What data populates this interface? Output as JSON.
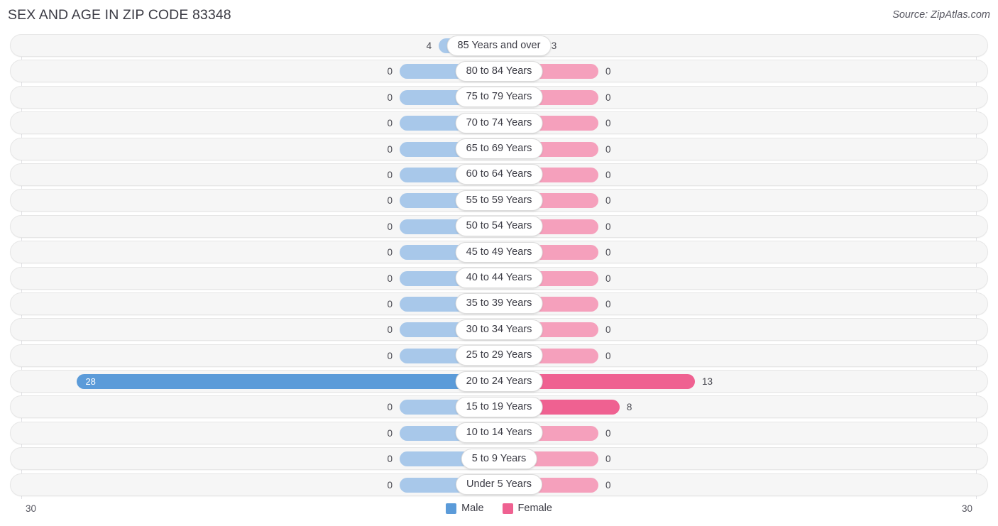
{
  "header": {
    "title": "SEX AND AGE IN ZIP CODE 83348",
    "source": "Source: ZipAtlas.com"
  },
  "legend": {
    "male_label": "Male",
    "female_label": "Female",
    "male_color": "#5b9bd9",
    "female_color": "#ef6191"
  },
  "axis": {
    "left_tick": "30",
    "right_tick": "30",
    "max": 30
  },
  "chart_data": {
    "type": "bar",
    "title": "SEX AND AGE IN ZIP CODE 83348",
    "subtitle": "Source: ZipAtlas.com",
    "orientation": "horizontal-diverging-population-pyramid",
    "xlabel": "",
    "ylabel": "",
    "xlim": [
      -30,
      30
    ],
    "axis_tick_labels": [
      "30",
      "30"
    ],
    "grid": false,
    "legend_position": "bottom-center",
    "categories": [
      "85 Years and over",
      "80 to 84 Years",
      "75 to 79 Years",
      "70 to 74 Years",
      "65 to 69 Years",
      "60 to 64 Years",
      "55 to 59 Years",
      "50 to 54 Years",
      "45 to 49 Years",
      "40 to 44 Years",
      "35 to 39 Years",
      "30 to 34 Years",
      "25 to 29 Years",
      "20 to 24 Years",
      "15 to 19 Years",
      "10 to 14 Years",
      "5 to 9 Years",
      "Under 5 Years"
    ],
    "series": [
      {
        "name": "Male",
        "color": "#a8c8ea",
        "highlight_color": "#5b9bd9",
        "values": [
          4,
          0,
          0,
          0,
          0,
          0,
          0,
          0,
          0,
          0,
          0,
          0,
          0,
          28,
          0,
          0,
          0,
          0
        ]
      },
      {
        "name": "Female",
        "color": "#f5a0bc",
        "highlight_color": "#ef6191",
        "values": [
          3,
          0,
          0,
          0,
          0,
          0,
          0,
          0,
          0,
          0,
          0,
          0,
          0,
          13,
          8,
          0,
          0,
          0
        ]
      }
    ]
  },
  "rows": [
    {
      "label": "85 Years and over",
      "male": "4",
      "female": "3",
      "male_hl": false,
      "female_hl": false
    },
    {
      "label": "80 to 84 Years",
      "male": "0",
      "female": "0",
      "male_hl": false,
      "female_hl": false
    },
    {
      "label": "75 to 79 Years",
      "male": "0",
      "female": "0",
      "male_hl": false,
      "female_hl": false
    },
    {
      "label": "70 to 74 Years",
      "male": "0",
      "female": "0",
      "male_hl": false,
      "female_hl": false
    },
    {
      "label": "65 to 69 Years",
      "male": "0",
      "female": "0",
      "male_hl": false,
      "female_hl": false
    },
    {
      "label": "60 to 64 Years",
      "male": "0",
      "female": "0",
      "male_hl": false,
      "female_hl": false
    },
    {
      "label": "55 to 59 Years",
      "male": "0",
      "female": "0",
      "male_hl": false,
      "female_hl": false
    },
    {
      "label": "50 to 54 Years",
      "male": "0",
      "female": "0",
      "male_hl": false,
      "female_hl": false
    },
    {
      "label": "45 to 49 Years",
      "male": "0",
      "female": "0",
      "male_hl": false,
      "female_hl": false
    },
    {
      "label": "40 to 44 Years",
      "male": "0",
      "female": "0",
      "male_hl": false,
      "female_hl": false
    },
    {
      "label": "35 to 39 Years",
      "male": "0",
      "female": "0",
      "male_hl": false,
      "female_hl": false
    },
    {
      "label": "30 to 34 Years",
      "male": "0",
      "female": "0",
      "male_hl": false,
      "female_hl": false
    },
    {
      "label": "25 to 29 Years",
      "male": "0",
      "female": "0",
      "male_hl": false,
      "female_hl": false
    },
    {
      "label": "20 to 24 Years",
      "male": "28",
      "female": "13",
      "male_hl": true,
      "female_hl": true
    },
    {
      "label": "15 to 19 Years",
      "male": "0",
      "female": "8",
      "male_hl": false,
      "female_hl": true
    },
    {
      "label": "10 to 14 Years",
      "male": "0",
      "female": "0",
      "male_hl": false,
      "female_hl": false
    },
    {
      "label": "5 to 9 Years",
      "male": "0",
      "female": "0",
      "male_hl": false,
      "female_hl": false
    },
    {
      "label": "Under 5 Years",
      "male": "0",
      "female": "0",
      "male_hl": false,
      "female_hl": false
    }
  ]
}
